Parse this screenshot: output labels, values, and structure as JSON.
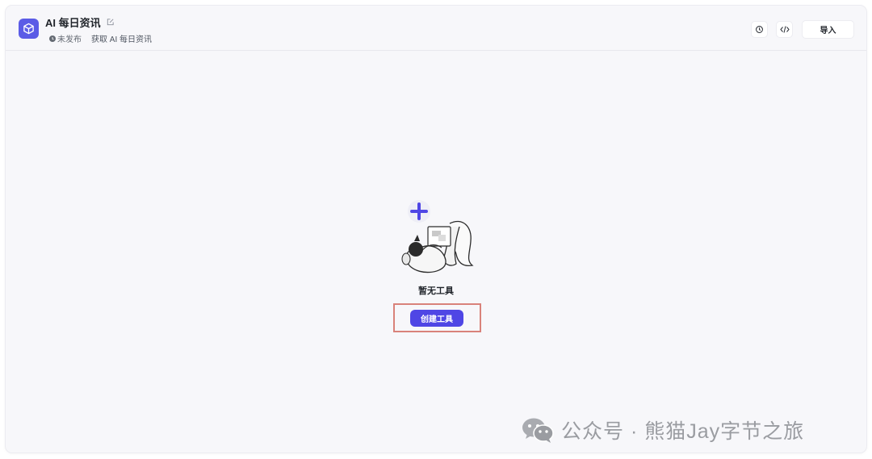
{
  "app": {
    "title": "AI 每日资讯",
    "status": "未发布",
    "description": "获取 AI 每日资讯",
    "icon": "cube-icon"
  },
  "header": {
    "history_icon": "history-icon",
    "code_icon": "code-icon",
    "import_label": "导入"
  },
  "empty_state": {
    "label": "暂无工具",
    "create_button": "创建工具"
  },
  "watermark": {
    "text": "公众号 · 熊猫Jay字节之旅"
  },
  "colors": {
    "accent": "#4f46e5",
    "highlight_border": "#d9827a",
    "background": "#f7f7fa"
  }
}
